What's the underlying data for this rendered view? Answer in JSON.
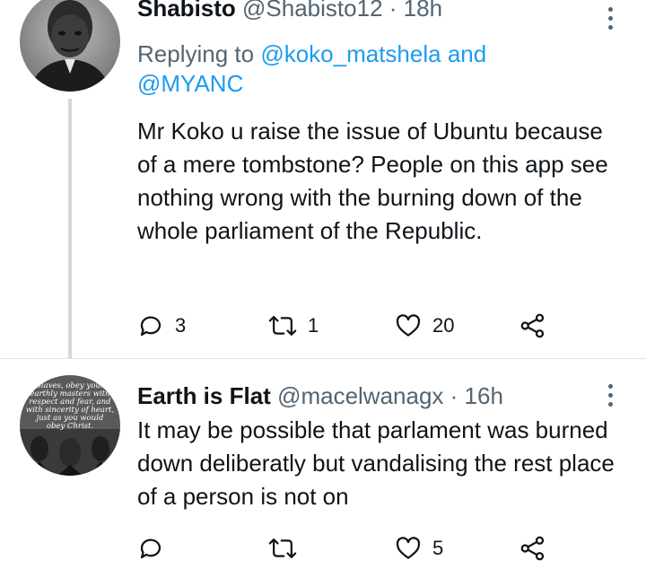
{
  "tweets": [
    {
      "name": "Shabisto",
      "handle": "@Shabisto12",
      "time": "· 18h",
      "replying_prefix": "Replying to",
      "replying_to_1": "@koko_matshela",
      "replying_and": "and",
      "replying_to_2": "@MYANC",
      "body": "Mr Koko u raise the issue of Ubuntu because of a mere tombstone? People on this app see nothing wrong with the burning down of the whole parliament of the Republic.",
      "replies": "3",
      "retweets": "1",
      "likes": "20"
    },
    {
      "name": "Earth is Flat",
      "handle": "@macelwanagx",
      "time": "· 16h",
      "body": "It may be possible that parlament was burned down deliberatly but vandalising the rest place of a person is not on",
      "replies": "",
      "retweets": "",
      "likes": "5",
      "avatar_text": "Slaves, obey your earthly masters with respect and fear, and with sincerity of heart, just as you would obey Christ."
    }
  ],
  "colors": {
    "text": "#0f1419",
    "secondary": "#536471",
    "link": "#1d9bf0",
    "thread_line": "#cfd9de"
  }
}
